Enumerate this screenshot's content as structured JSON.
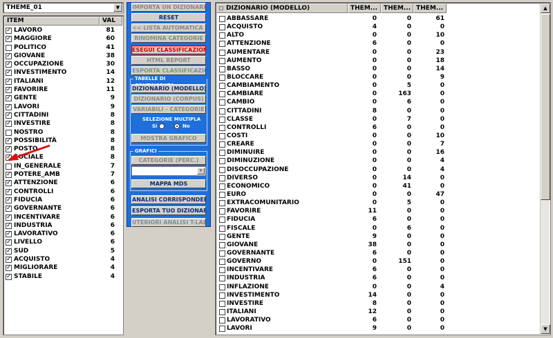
{
  "theme_selector": {
    "value": "THEME_01"
  },
  "items_list": {
    "headers": {
      "item": "ITEM",
      "val": "VAL"
    },
    "rows": [
      {
        "name": "LAVORO",
        "val": "81",
        "checked": true
      },
      {
        "name": "MAGGIORE",
        "val": "60",
        "checked": true
      },
      {
        "name": "POLITICO",
        "val": "41",
        "checked": false
      },
      {
        "name": "GIOVANE",
        "val": "38",
        "checked": true
      },
      {
        "name": "OCCUPAZIONE",
        "val": "30",
        "checked": true
      },
      {
        "name": "INVESTIMENTO",
        "val": "14",
        "checked": true
      },
      {
        "name": "ITALIANI",
        "val": "12",
        "checked": true
      },
      {
        "name": "FAVORIRE",
        "val": "11",
        "checked": true
      },
      {
        "name": "GENTE",
        "val": "9",
        "checked": true
      },
      {
        "name": "LAVORI",
        "val": "9",
        "checked": true
      },
      {
        "name": "CITTADINI",
        "val": "8",
        "checked": true
      },
      {
        "name": "INVESTIRE",
        "val": "8",
        "checked": true
      },
      {
        "name": "NOSTRO",
        "val": "8",
        "checked": false
      },
      {
        "name": "POSSIBILITÀ",
        "val": "8",
        "checked": true
      },
      {
        "name": "POSTO",
        "val": "8",
        "checked": true
      },
      {
        "name": "SOCIALE",
        "val": "8",
        "checked": true
      },
      {
        "name": "IN_GENERALE",
        "val": "7",
        "checked": false
      },
      {
        "name": "POTERE_AMB",
        "val": "7",
        "checked": true
      },
      {
        "name": "ATTENZIONE",
        "val": "6",
        "checked": true
      },
      {
        "name": "CONTROLLI",
        "val": "6",
        "checked": true
      },
      {
        "name": "FIDUCIA",
        "val": "6",
        "checked": true
      },
      {
        "name": "GOVERNANTE",
        "val": "6",
        "checked": true
      },
      {
        "name": "INCENTIVARE",
        "val": "6",
        "checked": true
      },
      {
        "name": "INDUSTRIA",
        "val": "6",
        "checked": true
      },
      {
        "name": "LAVORATIVO",
        "val": "6",
        "checked": true
      },
      {
        "name": "LIVELLO",
        "val": "6",
        "checked": true
      },
      {
        "name": "SUD",
        "val": "5",
        "checked": true
      },
      {
        "name": "ACQUISTO",
        "val": "4",
        "checked": true
      },
      {
        "name": "MIGLIORARE",
        "val": "4",
        "checked": true
      },
      {
        "name": "STABILE",
        "val": "4",
        "checked": true
      }
    ]
  },
  "buttons": {
    "importa": "IMPORTA UN DIZIONARIO",
    "reset": "RESET",
    "lista_automatica": "<< LISTA AUTOMATICA <<",
    "rinomina": "RINOMINA CATEGORIE",
    "esegui": "ESEGUI CLASSIFICAZIONE",
    "html_report": "HTML REPORT",
    "esporta_class": "ESPORTA CLASSIFICAZIONE",
    "dizionario_modello": "DIZIONARIO (MODELLO)",
    "dizionario_corpus": "DIZIONARIO (CORPUS)",
    "variabili": "VARIABILI - CATEGORIE",
    "mostra_grafico": "MOSTRA GRAFICO",
    "categorie_perc": "CATEGORIE  (PERC.)",
    "mappa_mds": "MAPPA  MDS",
    "analisi_corr": "ANALISI CORRISPONDENZE",
    "esporta_diz": "ESPORTA TUO DIZIONARIO",
    "ulteriori": "UTERIORI ANALISI T-LAB"
  },
  "contingency_group": {
    "title": "TABELLE DI CONTINGENZA",
    "multi_label": "SELEZIONE MULTIPLA",
    "si_label": "Sì",
    "no_label": "No",
    "selected": "No"
  },
  "grafici_group": {
    "title": "GRAFICI",
    "combo_value": ""
  },
  "dict_table": {
    "headers": {
      "name": "DIZIONARIO (MODELLO)",
      "c1": "THEM...",
      "c2": "THEM...",
      "c3": "THEM..."
    },
    "rows": [
      {
        "name": "ABBASSARE",
        "c1": "0",
        "c2": "0",
        "c3": "61"
      },
      {
        "name": "ACQUISTO",
        "c1": "4",
        "c2": "0",
        "c3": "0"
      },
      {
        "name": "ALTO",
        "c1": "0",
        "c2": "0",
        "c3": "10"
      },
      {
        "name": "ATTENZIONE",
        "c1": "6",
        "c2": "0",
        "c3": "0"
      },
      {
        "name": "AUMENTARE",
        "c1": "0",
        "c2": "0",
        "c3": "23"
      },
      {
        "name": "AUMENTO",
        "c1": "0",
        "c2": "0",
        "c3": "18"
      },
      {
        "name": "BASSO",
        "c1": "0",
        "c2": "0",
        "c3": "14"
      },
      {
        "name": "BLOCCARE",
        "c1": "0",
        "c2": "0",
        "c3": "9"
      },
      {
        "name": "CAMBIAMENTO",
        "c1": "0",
        "c2": "5",
        "c3": "0"
      },
      {
        "name": "CAMBIARE",
        "c1": "0",
        "c2": "163",
        "c3": "0"
      },
      {
        "name": "CAMBIO",
        "c1": "0",
        "c2": "6",
        "c3": "0"
      },
      {
        "name": "CITTADINI",
        "c1": "8",
        "c2": "0",
        "c3": "0"
      },
      {
        "name": "CLASSE",
        "c1": "0",
        "c2": "7",
        "c3": "0"
      },
      {
        "name": "CONTROLLI",
        "c1": "6",
        "c2": "0",
        "c3": "0"
      },
      {
        "name": "COSTI",
        "c1": "0",
        "c2": "0",
        "c3": "10"
      },
      {
        "name": "CREARE",
        "c1": "0",
        "c2": "0",
        "c3": "7"
      },
      {
        "name": "DIMINUIRE",
        "c1": "0",
        "c2": "0",
        "c3": "16"
      },
      {
        "name": "DIMINUZIONE",
        "c1": "0",
        "c2": "0",
        "c3": "4"
      },
      {
        "name": "DISOCCUPAZIONE",
        "c1": "0",
        "c2": "0",
        "c3": "4"
      },
      {
        "name": "DIVERSO",
        "c1": "0",
        "c2": "14",
        "c3": "0"
      },
      {
        "name": "ECONOMICO",
        "c1": "0",
        "c2": "41",
        "c3": "0"
      },
      {
        "name": "EURO",
        "c1": "0",
        "c2": "0",
        "c3": "47"
      },
      {
        "name": "EXTRACOMUNITARIO",
        "c1": "0",
        "c2": "5",
        "c3": "0"
      },
      {
        "name": "FAVORIRE",
        "c1": "11",
        "c2": "0",
        "c3": "0"
      },
      {
        "name": "FIDUCIA",
        "c1": "6",
        "c2": "0",
        "c3": "0"
      },
      {
        "name": "FISCALE",
        "c1": "0",
        "c2": "6",
        "c3": "0"
      },
      {
        "name": "GENTE",
        "c1": "9",
        "c2": "0",
        "c3": "0"
      },
      {
        "name": "GIOVANE",
        "c1": "38",
        "c2": "0",
        "c3": "0"
      },
      {
        "name": "GOVERNANTE",
        "c1": "6",
        "c2": "0",
        "c3": "0"
      },
      {
        "name": "GOVERNO",
        "c1": "0",
        "c2": "151",
        "c3": "0"
      },
      {
        "name": "INCENTIVARE",
        "c1": "6",
        "c2": "0",
        "c3": "0"
      },
      {
        "name": "INDUSTRIA",
        "c1": "6",
        "c2": "0",
        "c3": "0"
      },
      {
        "name": "INFLAZIONE",
        "c1": "0",
        "c2": "0",
        "c3": "4"
      },
      {
        "name": "INVESTIMENTO",
        "c1": "14",
        "c2": "0",
        "c3": "0"
      },
      {
        "name": "INVESTIRE",
        "c1": "8",
        "c2": "0",
        "c3": "0"
      },
      {
        "name": "ITALIANI",
        "c1": "12",
        "c2": "0",
        "c3": "0"
      },
      {
        "name": "LAVORATIVO",
        "c1": "6",
        "c2": "0",
        "c3": "0"
      },
      {
        "name": "LAVORI",
        "c1": "9",
        "c2": "0",
        "c3": "0"
      }
    ]
  },
  "colors": {
    "panel_blue": "#1e6fd9",
    "annotation_red": "#e01010"
  }
}
